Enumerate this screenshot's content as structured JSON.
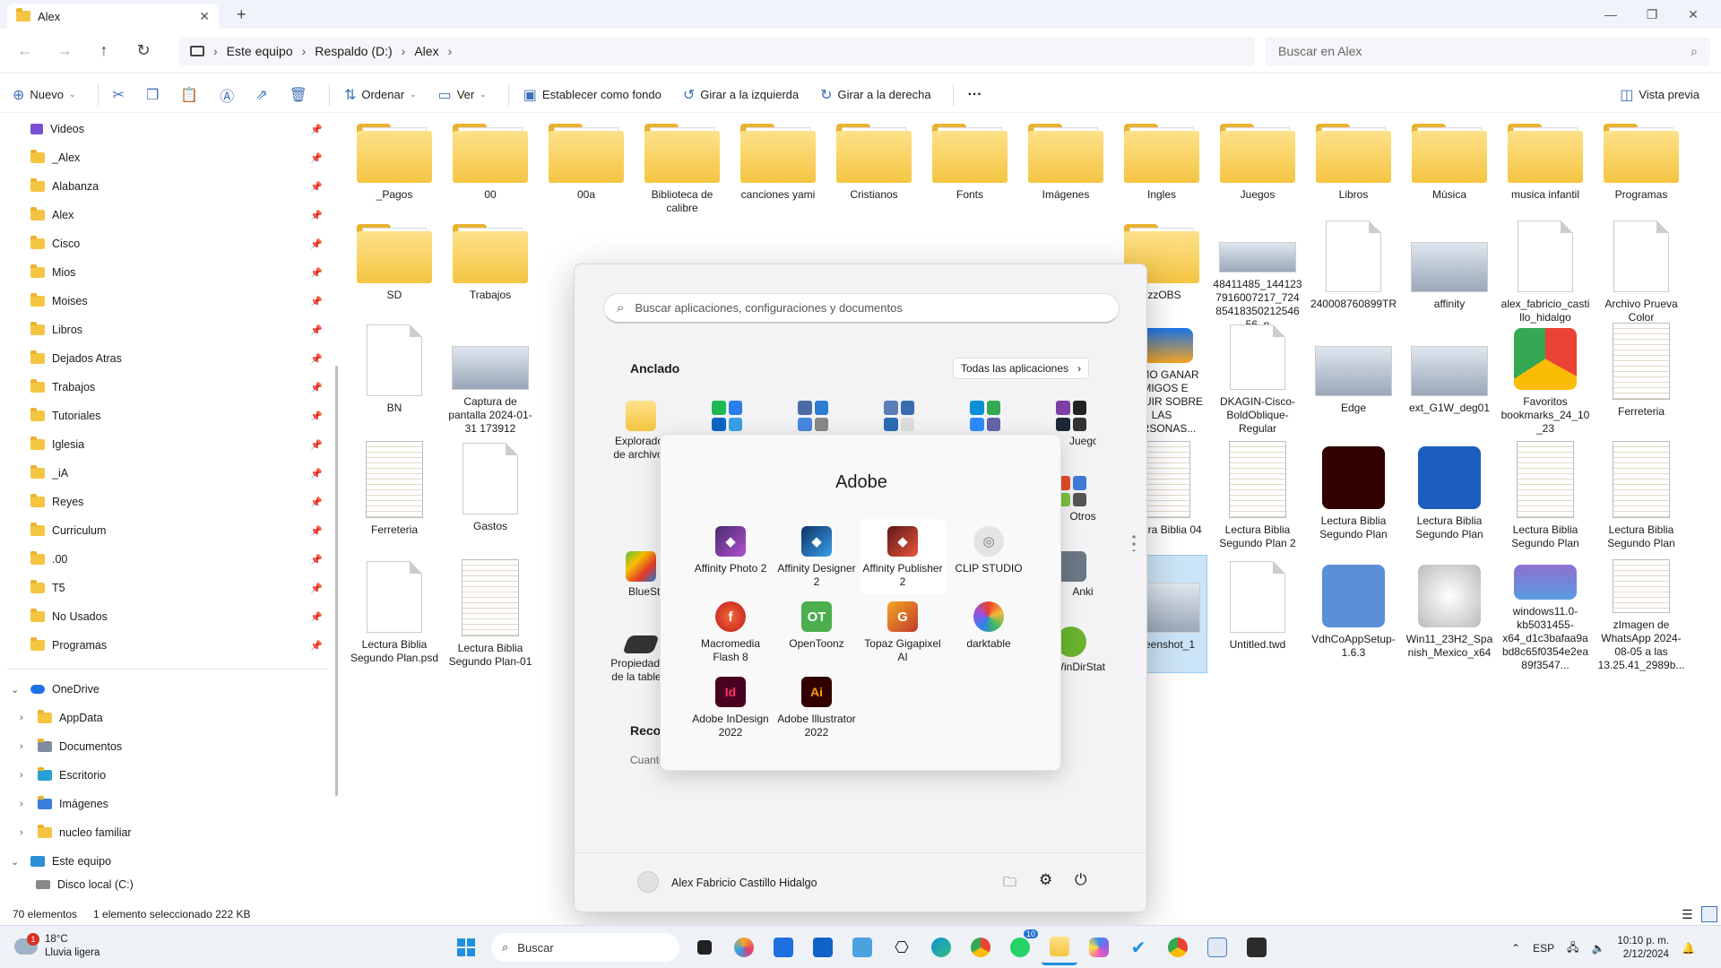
{
  "window": {
    "tab_title": "Alex",
    "new_tab": "+"
  },
  "nav": {
    "breadcrumb": [
      "Este equipo",
      "Respaldo (D:)",
      "Alex"
    ],
    "search_placeholder": "Buscar en Alex"
  },
  "toolbar": {
    "new": "Nuevo",
    "sort": "Ordenar",
    "view": "Ver",
    "set_bg": "Establecer como fondo",
    "rotate_left": "Girar a la izquierda",
    "rotate_right": "Girar a la derecha",
    "more": "···",
    "preview": "Vista previa"
  },
  "sidebar": {
    "pinned": [
      "Videos",
      "_Alex",
      "Alabanza",
      "Alex",
      "Cisco",
      "Mios",
      "Moises",
      "Libros",
      "Dejados Atras",
      "Trabajos",
      "Tutoriales",
      "Iglesia",
      "_iA",
      "Reyes",
      "Curriculum",
      ".00",
      "T5",
      "No Usados",
      "Programas"
    ],
    "onedrive": "OneDrive",
    "onedrive_items": [
      "AppData",
      "Documentos",
      "Escritorio",
      "Imágenes",
      "nucleo familiar"
    ],
    "this_pc": "Este equipo",
    "disk": "Disco local (C:)"
  },
  "files": {
    "row1": [
      "_Pagos",
      "00",
      "00a",
      "Biblioteca de calibre",
      "canciones yami",
      "Cristianos",
      "Fonts",
      "Imágenes",
      "Ingles",
      "Juegos",
      "Libros",
      "Música",
      "musica infantil",
      "Programas"
    ],
    "row2_left": [
      "SD",
      "Trabajos"
    ],
    "row2_right": [
      "zzzOBS",
      "48411485_1441237916007217_7248541835021254656_n",
      "240008760899TR",
      "affinity",
      "alex_fabricio_castillo_hidalgo",
      "Archivo Prueva Color"
    ],
    "row3_left": [
      "BN",
      "Captura de pantalla 2024-01-31 173912"
    ],
    "row3_right": [
      "COMO GANAR AMIGOS E INFLUIR SOBRE LAS PERSONAS...",
      "DKAGIN-Cisco-BoldOblique-Regular",
      "Edge",
      "ext_G1W_deg01",
      "Favoritos bookmarks_24_10_23",
      "Ferreteria"
    ],
    "row4_left": [
      "Ferreteria",
      "Gastos"
    ],
    "row4_right": [
      "Lectura Biblia 04",
      "Lectura Biblia Segundo Plan 2",
      "Lectura Biblia Segundo Plan",
      "Lectura Biblia Segundo Plan",
      "Lectura Biblia Segundo Plan",
      "Lectura Biblia Segundo Plan"
    ],
    "row5_left": [
      "Lectura Biblia Segundo Plan.psd",
      "Lectura Biblia Segundo Plan-01"
    ],
    "row5_right": [
      "Screenshot_1",
      "Untitled.twd",
      "VdhCoAppSetup-1.6.3",
      "Win11_23H2_Spanish_Mexico_x64",
      "windows11.0-kb5031455-x64_d1c3bafaa9abd8c65f0354e2ea89f3547...",
      "zImagen de WhatsApp 2024-08-05 a las 13.25.41_2989b..."
    ]
  },
  "status": {
    "count": "70 elementos",
    "selected": "1 elemento seleccionado  222 KB"
  },
  "start": {
    "search_placeholder": "Buscar aplicaciones, configuraciones y documentos",
    "pinned_title": "Anclado",
    "all_apps": "Todas las aplicaciones",
    "pinned": [
      "Explorador de archivos",
      "",
      "",
      "",
      "",
      "Juegos"
    ],
    "side_labels": [
      "Otros",
      "BlueStacks",
      "Anki",
      "Propiedades de la tableta",
      "WinDirStat"
    ],
    "recommended": "Recomendado",
    "recommended_sub": "Cuanto",
    "user": "Alex Fabricio Castillo Hidalgo"
  },
  "adobe": {
    "title": "Adobe",
    "apps": [
      "Affinity Photo 2",
      "Affinity Designer 2",
      "Affinity Publisher 2",
      "CLIP STUDIO",
      "Macromedia Flash 8",
      "OpenToonz",
      "Topaz Gigapixel AI",
      "darktable",
      "Adobe InDesign 2022",
      "Adobe Illustrator 2022"
    ]
  },
  "taskbar": {
    "weather_temp": "18°C",
    "weather_desc": "Lluvia ligera",
    "search": "Buscar",
    "lang": "ESP",
    "time": "10:10 p. m.",
    "date": "2/12/2024",
    "badge_whatsapp": "10"
  }
}
